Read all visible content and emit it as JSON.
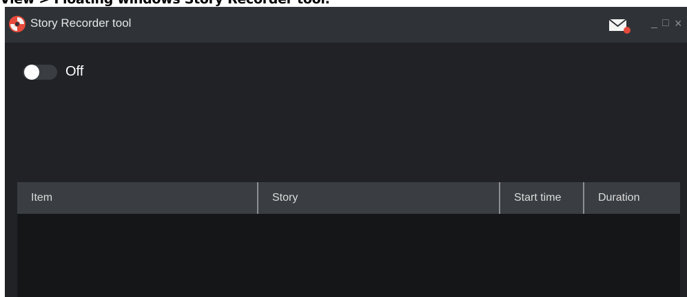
{
  "caption": "View > Floating windows Story Recorder tool.",
  "window": {
    "title": "Story Recorder tool",
    "controls": {
      "minimize": "_",
      "maximize": "□",
      "close": "×"
    },
    "icons": {
      "app": "app-logo-icon",
      "mail": "mail-notification-icon"
    },
    "colors": {
      "accent_red": "#e64a3b",
      "titlebar": "#2f3337",
      "background": "#202226"
    }
  },
  "toggle": {
    "state": "off",
    "label": "Off"
  },
  "table": {
    "columns": [
      "Item",
      "Story",
      "Start time",
      "Duration"
    ],
    "rows": []
  }
}
